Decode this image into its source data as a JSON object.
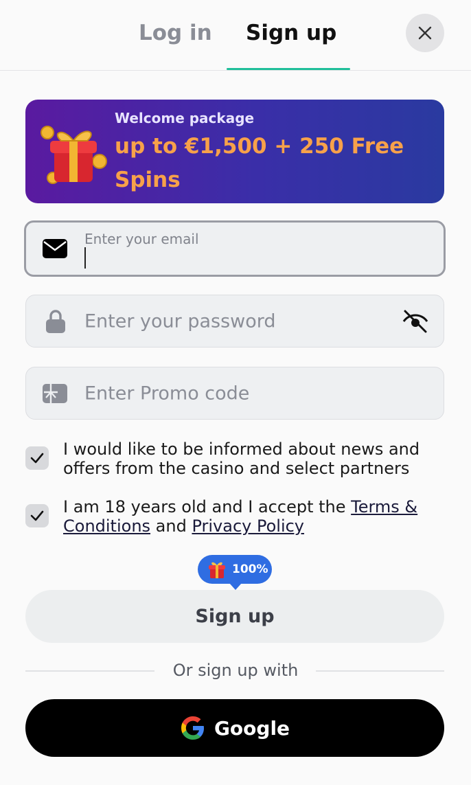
{
  "tabs": {
    "login": "Log in",
    "signup": "Sign up"
  },
  "banner": {
    "kicker": "Welcome package",
    "offer": "up to €1,500 + 250 Free Spins"
  },
  "email": {
    "label": "Enter your email",
    "value": ""
  },
  "password": {
    "placeholder": "Enter your password"
  },
  "promo": {
    "placeholder": "Enter Promo code"
  },
  "consents": {
    "news": {
      "checked": true,
      "text": "I would like to be informed about news and offers from the casino and select partners"
    },
    "age": {
      "checked": true,
      "prefix": "I am 18 years old and I accept the ",
      "terms_link": "Terms & Conditions",
      "middle": " and ",
      "privacy_link": "Privacy Policy"
    }
  },
  "bonus_badge": "100%",
  "signup_button": "Sign up",
  "divider_text": "Or sign up with",
  "google_button": "Google",
  "colors": {
    "accent_underline": "#1fbf9a",
    "offer": "#f7a14a",
    "badge": "#2f6de2"
  },
  "icons": [
    "close-icon",
    "gift-icon",
    "mail-icon",
    "lock-icon",
    "eye-off-icon",
    "promo-card-icon",
    "check-icon",
    "google-icon"
  ]
}
